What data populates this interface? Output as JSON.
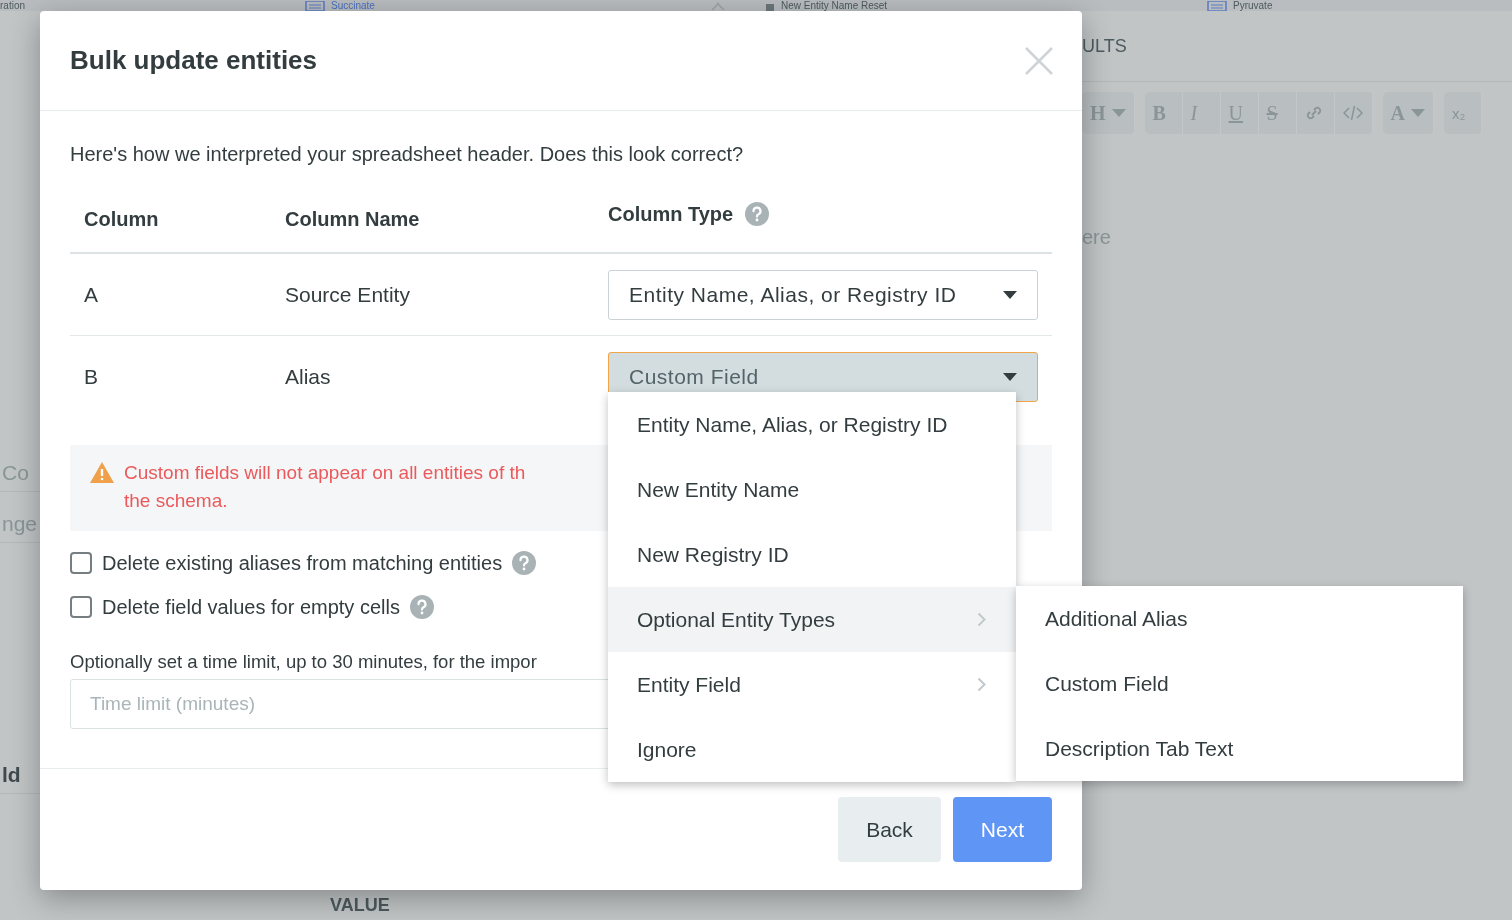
{
  "background": {
    "top_tabs": [
      {
        "label": "ration",
        "kind": "plain",
        "closable": false
      },
      {
        "label": "Succinate",
        "kind": "list",
        "closable": true
      },
      {
        "label": "New Entity Name Reset",
        "kind": "lock",
        "closable": false
      },
      {
        "label": "Pyruvate",
        "kind": "list",
        "closable": false
      }
    ],
    "left_fragments": [
      {
        "text": "Co",
        "bold": false
      },
      {
        "text": "nge",
        "bold": false
      },
      {
        "text": "ld",
        "bold": true
      }
    ],
    "results_heading": "ULTS",
    "toolbar": [
      [
        {
          "kind": "bold",
          "label": "H",
          "dropdown": true
        }
      ],
      [
        {
          "kind": "bold",
          "label": "B",
          "dropdown": false
        },
        {
          "kind": "italic",
          "label": "I",
          "dropdown": false
        },
        {
          "kind": "underline",
          "label": "U",
          "dropdown": false
        },
        {
          "kind": "strike",
          "label": "S",
          "dropdown": false
        },
        {
          "kind": "link",
          "dropdown": false
        },
        {
          "kind": "code",
          "dropdown": false
        }
      ],
      [
        {
          "kind": "bold",
          "label": "A",
          "dropdown": true
        }
      ],
      [
        {
          "kind": "plain",
          "label": "x₂",
          "dropdown": false
        }
      ]
    ],
    "editor_placeholder": "ere",
    "table_header": "VALUE"
  },
  "dialog": {
    "title": "Bulk update entities",
    "intro": "Here's how we interpreted your spreadsheet header. Does this look correct?",
    "columns": [
      "Column",
      "Column Name",
      "Column Type"
    ],
    "rows": [
      {
        "column": "A",
        "name": "Source Entity",
        "type": "Entity Name, Alias, or Registry ID",
        "open": false
      },
      {
        "column": "B",
        "name": "Alias",
        "type": "Custom Field",
        "open": true
      }
    ],
    "warning": [
      "Custom fields will not appear on all entities of th",
      "the schema."
    ],
    "options": [
      {
        "label": "Delete existing aliases from matching entities",
        "checked": false
      },
      {
        "label": "Delete field values for empty cells",
        "checked": false
      }
    ],
    "time_limit_label": "Optionally set a time limit, up to 30 minutes, for the impor",
    "time_limit": {
      "placeholder": "Time limit (minutes)"
    },
    "buttons": [
      {
        "label": "Back",
        "kind": "secondary"
      },
      {
        "label": "Next",
        "kind": "primary"
      }
    ],
    "menu": [
      {
        "label": "Entity Name, Alias, or Registry ID",
        "kind": "item",
        "selected": false
      },
      {
        "label": "New Entity Name",
        "kind": "item",
        "selected": false
      },
      {
        "label": "New Registry ID",
        "kind": "item",
        "selected": false
      },
      {
        "label": "Optional Entity Types",
        "kind": "submenu",
        "selected": true
      },
      {
        "label": "Entity Field",
        "kind": "submenu",
        "selected": false
      },
      {
        "label": "Ignore",
        "kind": "item",
        "selected": false
      }
    ],
    "submenu": [
      {
        "label": "Additional Alias",
        "selected": false
      },
      {
        "label": "Custom Field",
        "selected": false
      },
      {
        "label": "Description Tab Text",
        "selected": false
      }
    ]
  }
}
